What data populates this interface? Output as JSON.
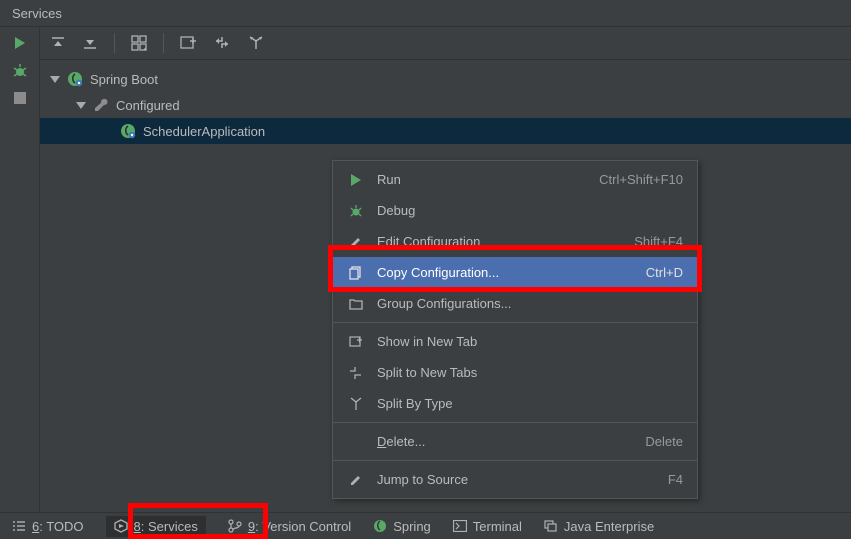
{
  "panel": {
    "title": "Services"
  },
  "tree": {
    "root": "Spring Boot",
    "configured": "Configured",
    "app": "SchedulerApplication"
  },
  "menu": {
    "run": {
      "label": "Run",
      "shortcut": "Ctrl+Shift+F10"
    },
    "debug": {
      "label": "Debug",
      "shortcut": ""
    },
    "edit": {
      "label": "Edit Configuration",
      "shortcut": "Shift+F4"
    },
    "copy": {
      "label": "Copy Configuration...",
      "shortcut": "Ctrl+D"
    },
    "group": {
      "label": "Group Configurations...",
      "shortcut": ""
    },
    "newtab": {
      "label": "Show in New Tab",
      "shortcut": ""
    },
    "split": {
      "label": "Split to New Tabs",
      "shortcut": ""
    },
    "bytype": {
      "label": "Split By Type",
      "shortcut": ""
    },
    "delete": {
      "label": "Delete...",
      "shortcut": "Delete"
    },
    "jump": {
      "label": "Jump to Source",
      "shortcut": "F4"
    }
  },
  "status": {
    "todo": "6: TODO",
    "services": "8: Services",
    "vcs": "9: Version Control",
    "spring": "Spring",
    "terminal": "Terminal",
    "java": "Java Enterprise"
  }
}
